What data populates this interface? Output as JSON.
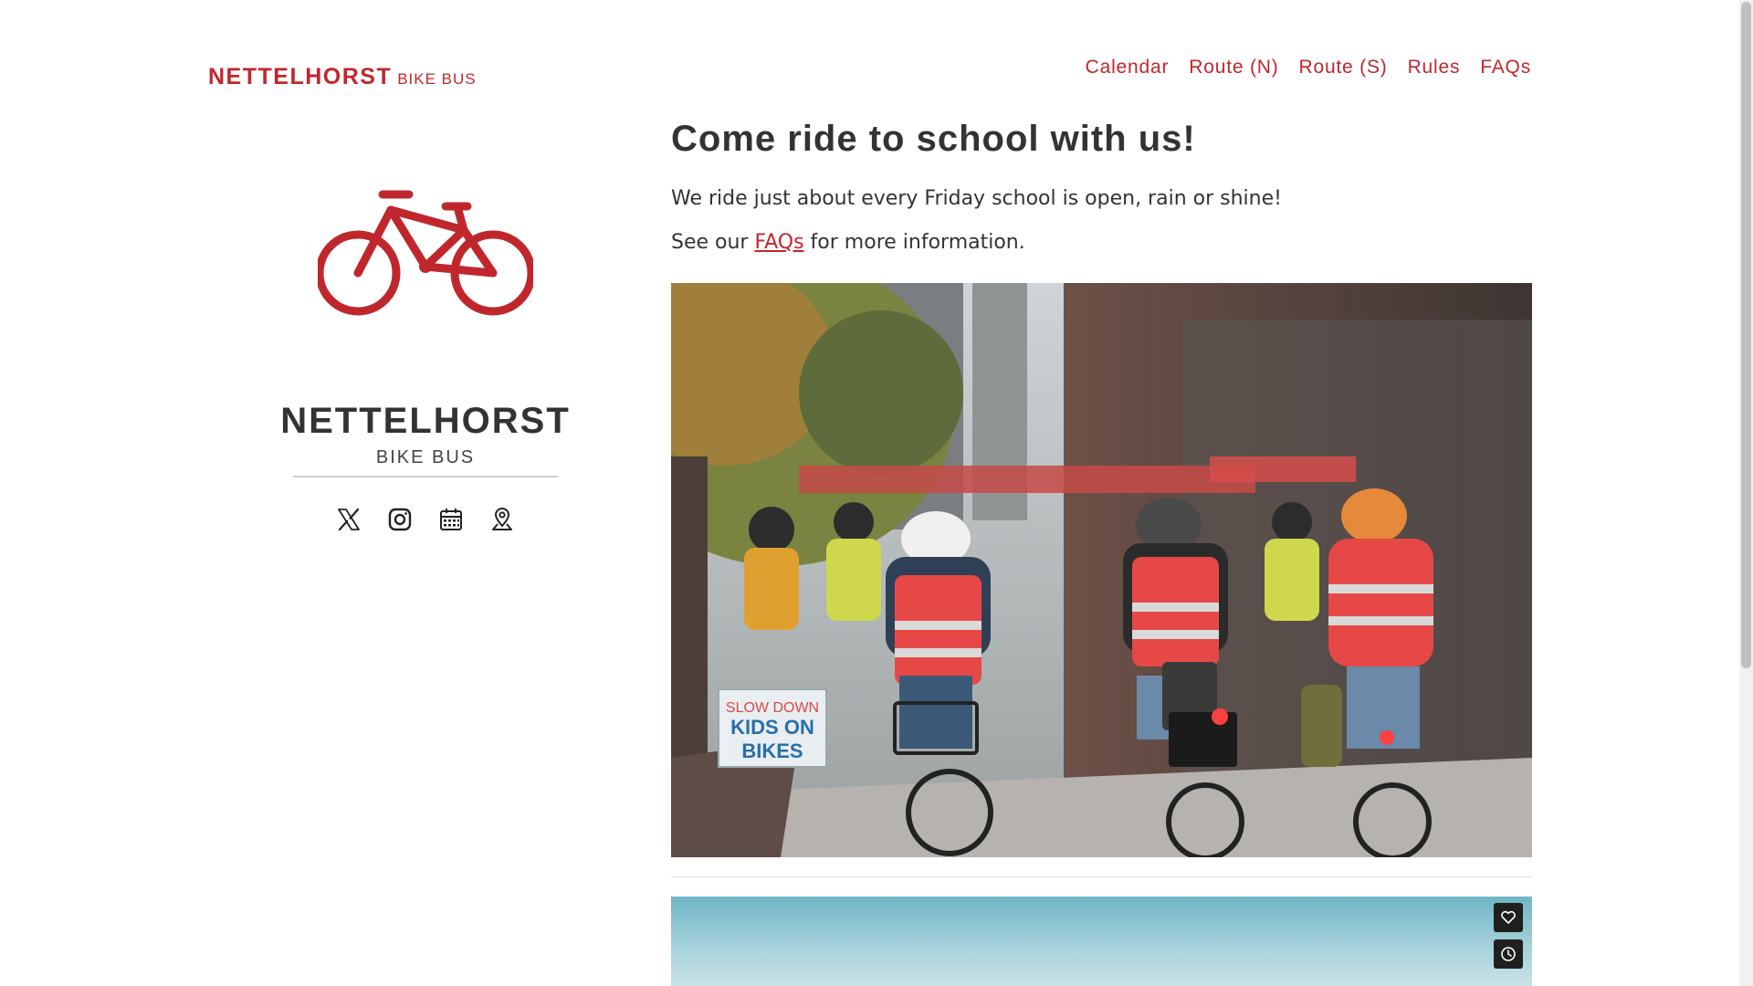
{
  "site": {
    "brand_name": "NETTELHORST",
    "brand_sub": "BIKE BUS"
  },
  "nav": {
    "items": [
      "Calendar",
      "Route (N)",
      "Route (S)",
      "Rules",
      "FAQs"
    ]
  },
  "profile": {
    "name": "NETTELHORST",
    "sub": "BIKE BUS",
    "accent_color": "#c0272d",
    "icons": [
      "x-twitter-icon",
      "instagram-icon",
      "calendar-icon",
      "map-pin-icon"
    ]
  },
  "main": {
    "heading": "Come ride to school with us!",
    "p1": "We ride just about every Friday school is open, rain or shine!",
    "p2_before": "See our ",
    "p2_link": "FAQs",
    "p2_after": " for more information.",
    "photo": {
      "sign_line1": "SLOW DOWN",
      "sign_line2": "KIDS ON",
      "sign_line3": "BIKES"
    },
    "video_buttons": [
      "heart-icon",
      "clock-icon"
    ]
  }
}
